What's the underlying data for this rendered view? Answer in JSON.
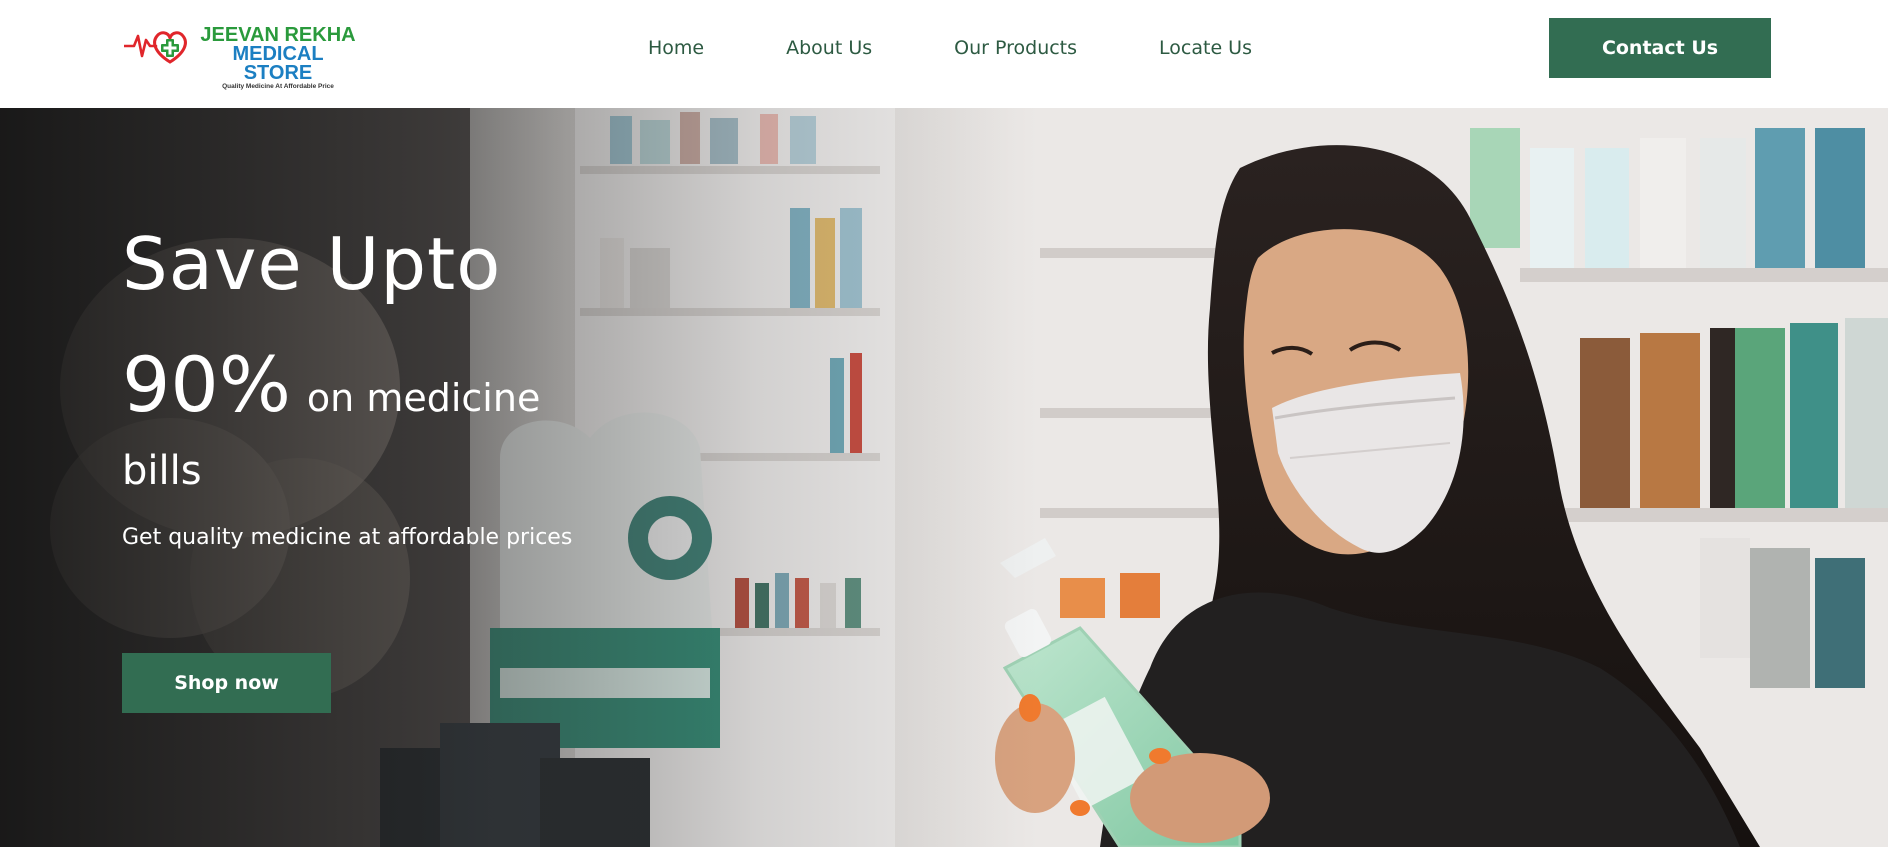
{
  "brand": {
    "name_line1": "JEEVAN REKHA",
    "name_line2": "MEDICAL STORE",
    "tagline": "Quality Medicine At Affordable Price",
    "logo_icon": "heart-pulse-cross-icon",
    "colors": {
      "green": "#2a9a3c",
      "blue": "#1c7fc2",
      "red": "#e0262b"
    }
  },
  "nav": {
    "items": [
      {
        "label": "Home"
      },
      {
        "label": "About Us"
      },
      {
        "label": "Our Products"
      },
      {
        "label": "Locate Us"
      }
    ],
    "link_color": "#2d5a42"
  },
  "header": {
    "contact_label": "Contact Us",
    "accent": "#326d52"
  },
  "hero": {
    "title": "Save Upto",
    "percent": "90%",
    "percent_suffix": "on medicine",
    "suffix_line2": "bills",
    "subtitle": "Get quality medicine at affordable prices",
    "cta_label": "Shop now",
    "image_subject": "woman-in-mask-reading-sanitizer-bottle-in-pharmacy"
  }
}
